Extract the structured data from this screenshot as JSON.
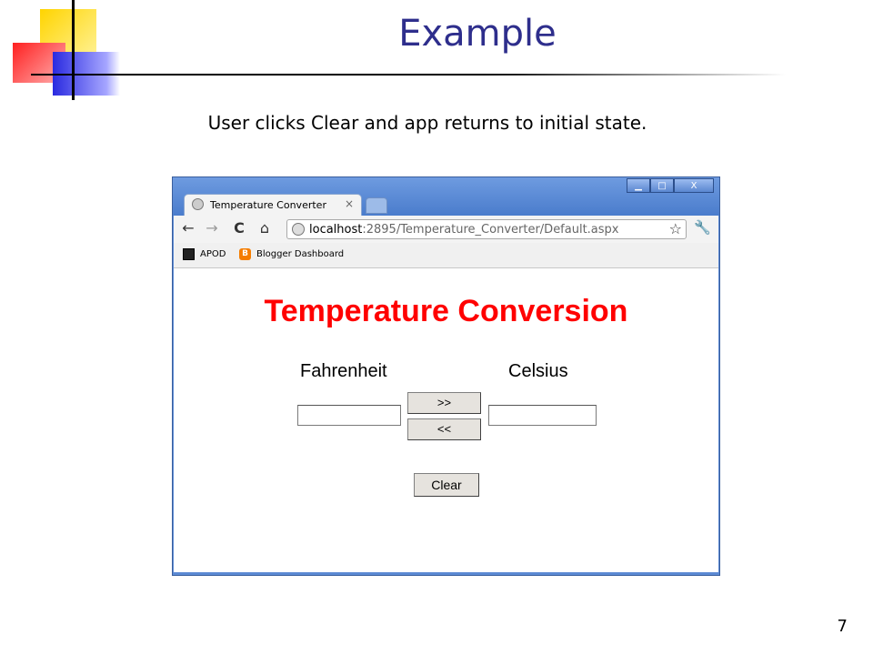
{
  "slide": {
    "title": "Example",
    "subtitle": "User clicks Clear and app returns to initial state.",
    "page_number": "7"
  },
  "browser": {
    "tab_title": "Temperature Converter",
    "tab_close": "×",
    "url_host": "localhost",
    "url_path": ":2895/Temperature_Converter/Default.aspx",
    "window_buttons": {
      "minimize": "▁",
      "maximize": "□",
      "close": "X"
    },
    "nav": {
      "back": "←",
      "forward": "→",
      "reload": "C",
      "home": "⌂",
      "star": "☆",
      "wrench": "🔧"
    },
    "bookmarks": [
      {
        "label": "APOD",
        "icon": "apod-icon"
      },
      {
        "label": "Blogger Dashboard",
        "icon": "blogger-icon",
        "glyph": "B"
      }
    ]
  },
  "app": {
    "title": "Temperature Conversion",
    "fahrenheit_label": "Fahrenheit",
    "celsius_label": "Celsius",
    "fahrenheit_value": "",
    "celsius_value": "",
    "to_celsius_button": ">>",
    "to_fahrenheit_button": "<<",
    "clear_button": "Clear"
  }
}
